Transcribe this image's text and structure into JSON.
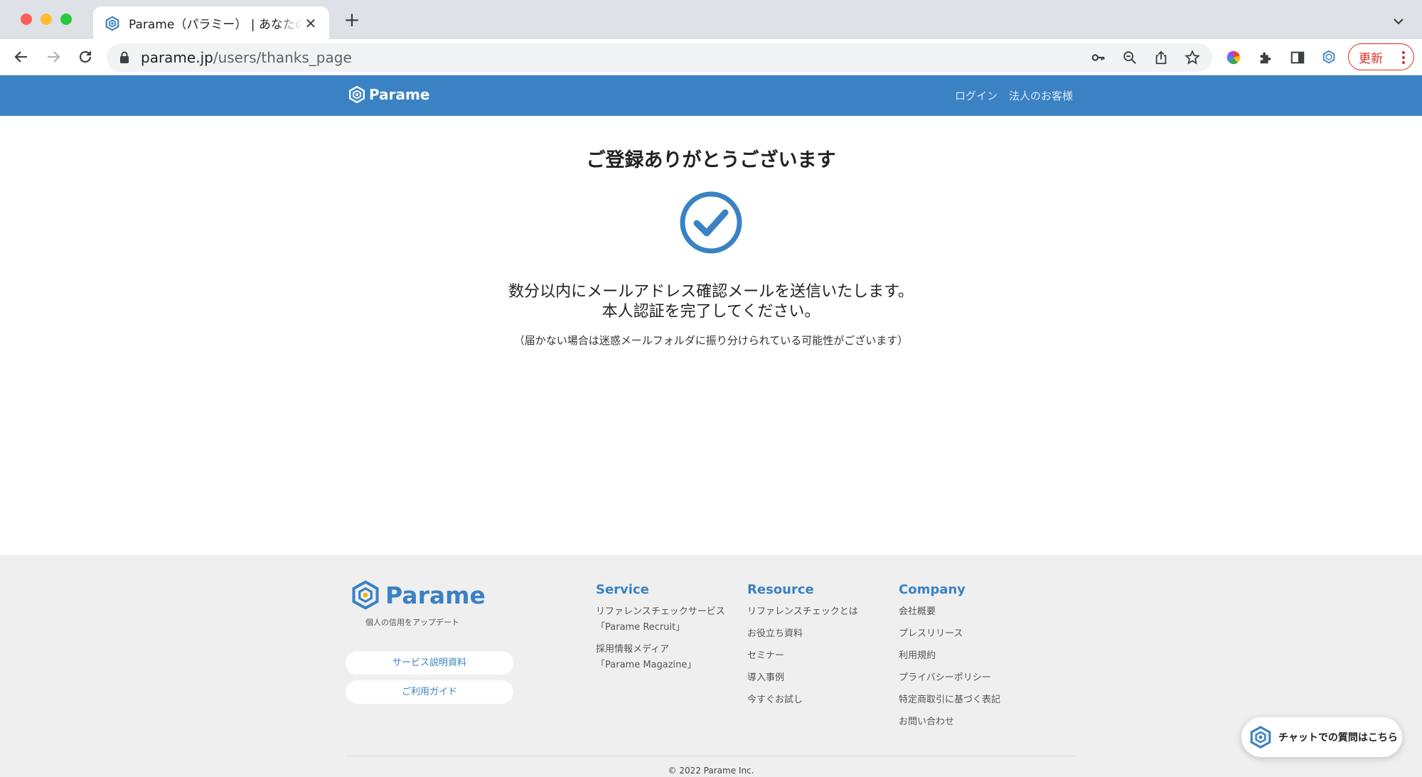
{
  "browser": {
    "tab_title": "Parame（パラミー） | あなたの\"信頼\"",
    "url_host": "parame.jp",
    "url_path": "/users/thanks_page",
    "update_label": "更新",
    "favicon_icon": "parame-logo-icon"
  },
  "header": {
    "logo_text": "Parame",
    "nav": [
      "ログイン",
      "法人のお客様"
    ]
  },
  "main": {
    "title": "ご登録ありがとうございます",
    "message_line1": "数分以内にメールアドレス確認メールを送信いたします。",
    "message_line2": "本人認証を完了してください。",
    "note": "（届かない場合は迷惑メールフォルダに振り分けられている可能性がございます）"
  },
  "footer": {
    "brand": "Parame",
    "tagline": "個人の信用をアップデート",
    "buttons": [
      "サービス説明資料",
      "ご利用ガイド"
    ],
    "service": {
      "title": "Service",
      "links": [
        [
          "リファレンスチェックサービス",
          "「Parame Recruit」"
        ],
        [
          "採用情報メディア",
          "「Parame Magazine」"
        ]
      ]
    },
    "resource": {
      "title": "Resource",
      "links": [
        "リファレンスチェックとは",
        "お役立ち資料",
        "セミナー",
        "導入事例",
        "今すぐお試し"
      ]
    },
    "company": {
      "title": "Company",
      "links": [
        "会社概要",
        "プレスリリース",
        "利用規約",
        "プライバシーポリシー",
        "特定商取引に基づく表記",
        "お問い合わせ"
      ]
    },
    "copyright": "© 2022 Parame Inc."
  },
  "chat": {
    "label": "チャットでの質問はこちら"
  },
  "colors": {
    "brand_blue": "#3b82c4",
    "update_red": "#d93025"
  }
}
